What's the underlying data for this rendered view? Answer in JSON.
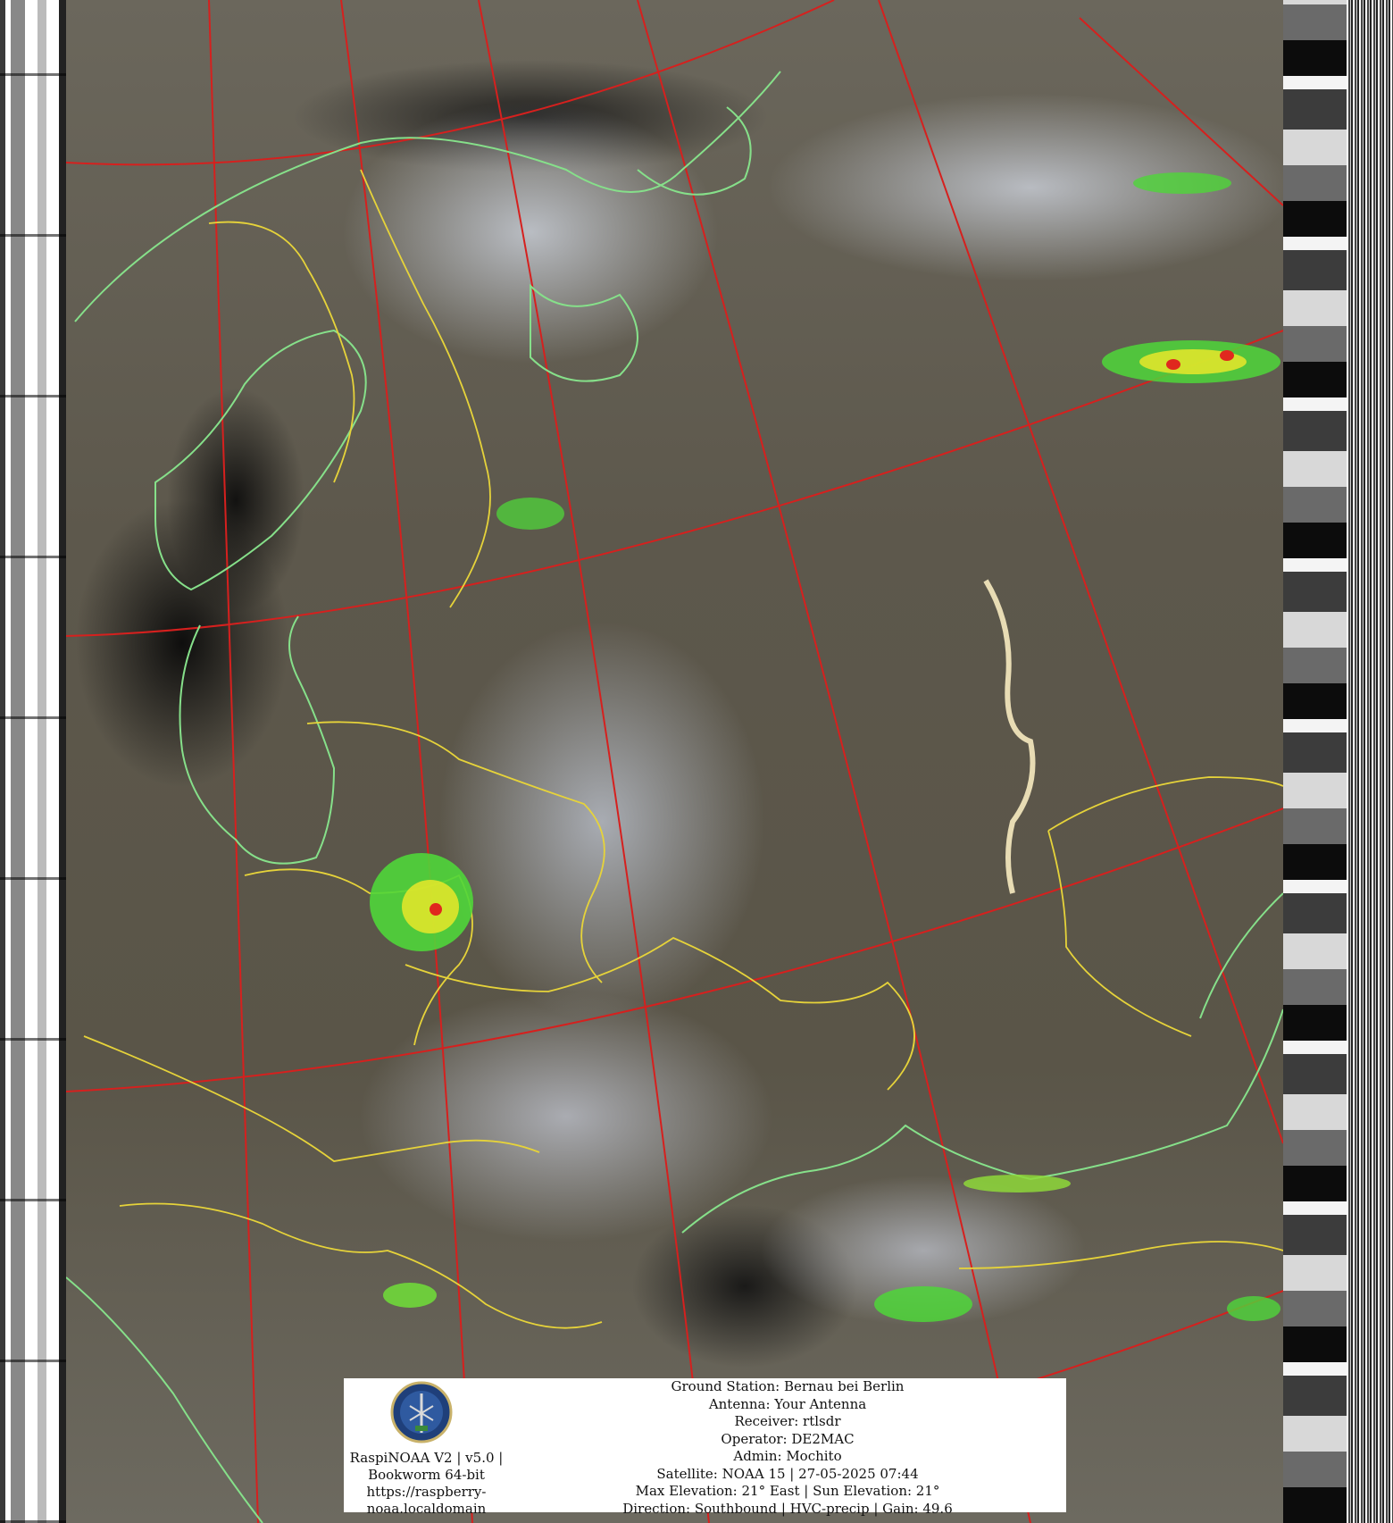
{
  "image": {
    "subject": "Color-composite weather satellite image of Eastern Europe with coastlines, borders, lat/lon grid and precipitation overlay",
    "colors": {
      "grid_lines": "#d6201e",
      "coastlines": "#86e08a",
      "borders": "#e6d33a",
      "precip_low": "#4fd63a",
      "precip_mid": "#e8e82a",
      "precip_high": "#e0281e"
    }
  },
  "station_logo": {
    "icon": "satellite-station-logo"
  },
  "software_info": {
    "line1": "RaspiNOAA V2 | v5.0 |",
    "line2": "Bookworm 64-bit",
    "line3": "https://raspberry-",
    "line4": "noaa.localdomain"
  },
  "pass_info": {
    "ground_station": "Ground Station: Bernau bei Berlin",
    "antenna": "Antenna: Your Antenna",
    "receiver": "Receiver: rtlsdr",
    "operator": "Operator: DE2MAC",
    "admin": "Admin: Mochito",
    "satellite": "Satellite: NOAA 15 | 27-05-2025 07:44",
    "elevation": "Max Elevation: 21° East | Sun Elevation: 21°",
    "direction": "Direction: Southbound | HVC-precip | Gain: 49.6"
  }
}
